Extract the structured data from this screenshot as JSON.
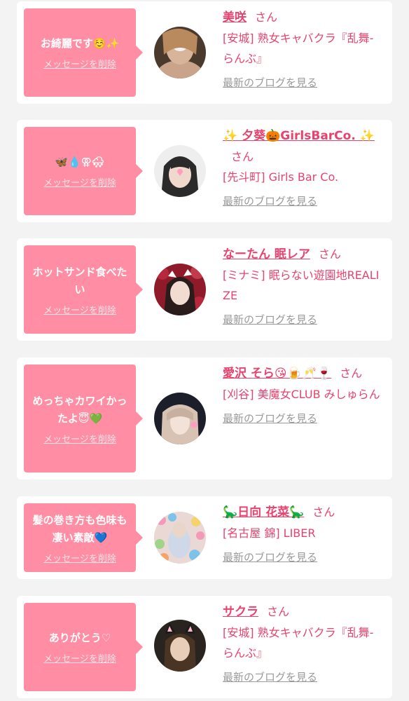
{
  "delete_label": "メッセージを削除",
  "blog_label": "最新のブログを見る",
  "san_label": "さん",
  "colors": {
    "accent": "#e8436e",
    "bubble": "#ff8ea4",
    "link_gray": "#9a9a9a",
    "background": "#f3f3f3"
  },
  "messages": [
    {
      "message": "お綺麗です☺️✨",
      "name": "美咲",
      "shop": "[安城] 熟女キャバクラ『乱舞-らんぶ』"
    },
    {
      "message": "🦋💧⚢🌨",
      "name": "✨ 夕葵🎃GirlsBarCo. ✨",
      "shop": "[先斗町] Girls Bar Co."
    },
    {
      "message": "ホットサンド食べたい",
      "name": "なーたん 眠レア",
      "shop": "[ミナミ] 眠らない遊園地REALIZE"
    },
    {
      "message": "めっちゃカワイかったよ😇💚",
      "name": "愛沢 そら😘🍺🥂🍷",
      "shop": "[刈谷] 美魔女CLUB みしゅらん"
    },
    {
      "message": "髪の巻き方も色味も凄い素敵💙",
      "name": "🦕日向 花菜🦕",
      "shop": "[名古屋 錦] LIBER"
    },
    {
      "message": "ありがとう♡",
      "name": "サクラ",
      "shop": "[安城] 熟女キャバクラ『乱舞-らんぶ』"
    }
  ]
}
